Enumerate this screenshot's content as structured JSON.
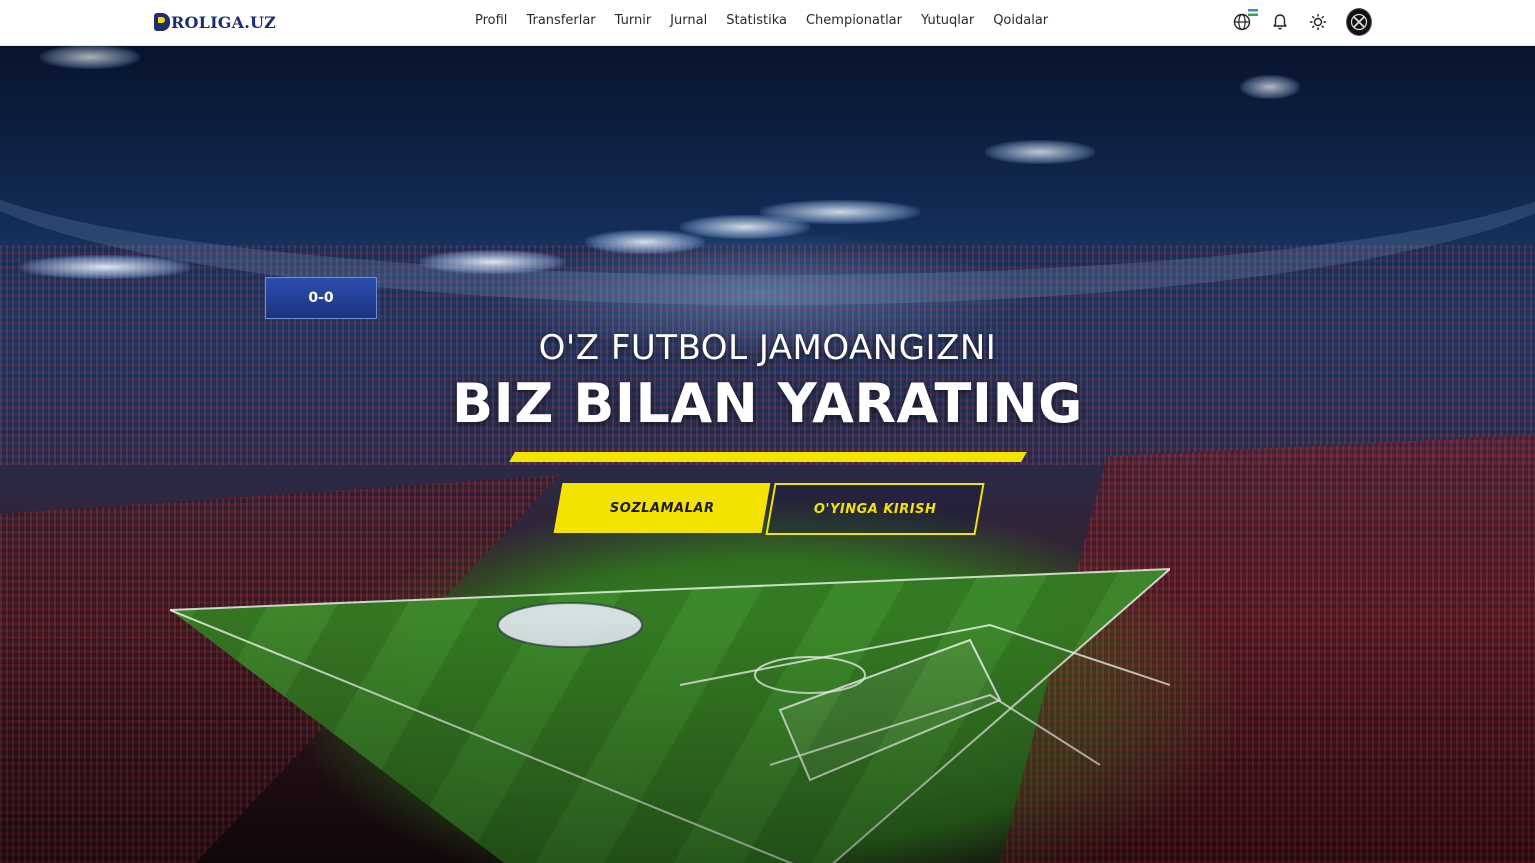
{
  "header": {
    "logo_letter": "P",
    "logo_text": "ROLIGA.UZ",
    "nav": [
      "Profil",
      "Transferlar",
      "Turnir",
      "Jurnal",
      "Statistika",
      "Chempionatlar",
      "Yutuqlar",
      "Qoidalar"
    ],
    "icons": [
      "globe-icon",
      "bell-icon",
      "sun-icon",
      "avatar"
    ]
  },
  "hero": {
    "line1": "O'Z FUTBOL JAMOANGIZNI",
    "line2": "BIZ BILAN YARATING",
    "primary_button": "SOZLAMALAR",
    "secondary_button": "O'YINGA KIRISH",
    "scoreboard": "0-0"
  },
  "colors": {
    "accent": "#f2e400",
    "brand": "#1e2d6b",
    "header_bg": "#ffffff"
  }
}
